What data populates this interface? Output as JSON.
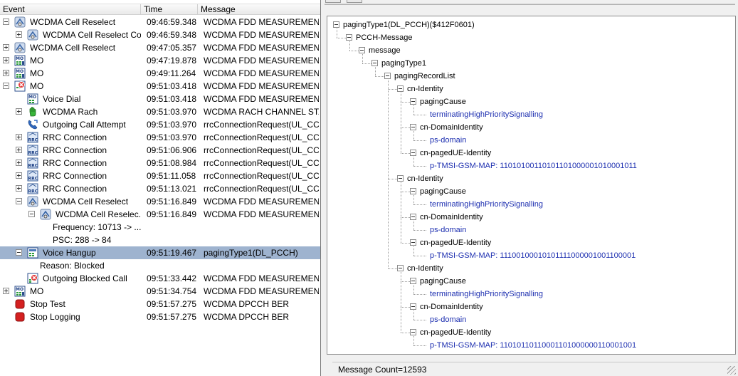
{
  "event_list": {
    "headers": {
      "event": "Event",
      "time": "Time",
      "message": "Message"
    },
    "rows": [
      {
        "indent": 0,
        "toggle": "minus",
        "icon": "cell-reselect",
        "event": "WCDMA Cell Reselect",
        "time": "09:46:59.348",
        "message": "WCDMA FDD MEASUREMENTS"
      },
      {
        "indent": 1,
        "toggle": "plus",
        "icon": "cell-reselect",
        "event": "WCDMA Cell Reselect Co...",
        "time": "09:46:59.348",
        "message": "WCDMA FDD MEASUREMENTS"
      },
      {
        "indent": 0,
        "toggle": "plus",
        "icon": "cell-reselect",
        "event": "WCDMA Cell Reselect",
        "time": "09:47:05.357",
        "message": "WCDMA FDD MEASUREMENTS"
      },
      {
        "indent": 0,
        "toggle": "plus",
        "icon": "mo",
        "event": "MO",
        "time": "09:47:19.878",
        "message": "WCDMA FDD MEASUREMENTS"
      },
      {
        "indent": 0,
        "toggle": "plus",
        "icon": "mo",
        "event": "MO",
        "time": "09:49:11.264",
        "message": "WCDMA FDD MEASUREMENTS"
      },
      {
        "indent": 0,
        "toggle": "minus",
        "icon": "mo-blocked",
        "event": "MO",
        "time": "09:51:03.418",
        "message": "WCDMA FDD MEASUREMENTS"
      },
      {
        "indent": 1,
        "toggle": "none",
        "icon": "voice-dial",
        "event": "Voice Dial",
        "time": "09:51:03.418",
        "message": "WCDMA FDD MEASUREMENTS"
      },
      {
        "indent": 1,
        "toggle": "plus",
        "icon": "rach-hand",
        "event": "WCDMA Rach",
        "time": "09:51:03.970",
        "message": "WCDMA RACH CHANNEL STATUS"
      },
      {
        "indent": 1,
        "toggle": "none",
        "icon": "call-attempt",
        "event": "Outgoing Call Attempt",
        "time": "09:51:03.970",
        "message": "rrcConnectionRequest(UL_CCCH)"
      },
      {
        "indent": 1,
        "toggle": "plus",
        "icon": "rrc",
        "event": "RRC Connection",
        "time": "09:51:03.970",
        "message": "rrcConnectionRequest(UL_CCCH)"
      },
      {
        "indent": 1,
        "toggle": "plus",
        "icon": "rrc",
        "event": "RRC Connection",
        "time": "09:51:06.906",
        "message": "rrcConnectionRequest(UL_CCCH)"
      },
      {
        "indent": 1,
        "toggle": "plus",
        "icon": "rrc",
        "event": "RRC Connection",
        "time": "09:51:08.984",
        "message": "rrcConnectionRequest(UL_CCCH)"
      },
      {
        "indent": 1,
        "toggle": "plus",
        "icon": "rrc",
        "event": "RRC Connection",
        "time": "09:51:11.058",
        "message": "rrcConnectionRequest(UL_CCCH)"
      },
      {
        "indent": 1,
        "toggle": "plus",
        "icon": "rrc",
        "event": "RRC Connection",
        "time": "09:51:13.021",
        "message": "rrcConnectionRequest(UL_CCCH)"
      },
      {
        "indent": 1,
        "toggle": "minus",
        "icon": "cell-reselect",
        "event": "WCDMA Cell Reselect",
        "time": "09:51:16.849",
        "message": "WCDMA FDD MEASUREMENTS"
      },
      {
        "indent": 2,
        "toggle": "minus",
        "icon": "cell-reselect",
        "event": "WCDMA Cell Reselec...",
        "time": "09:51:16.849",
        "message": "WCDMA FDD MEASUREMENTS"
      },
      {
        "indent": 3,
        "toggle": "none",
        "icon": "none",
        "event": "Frequency: 10713 -> ...",
        "time": "",
        "message": ""
      },
      {
        "indent": 3,
        "toggle": "none",
        "icon": "none",
        "event": "PSC: 288 -> 84",
        "time": "",
        "message": ""
      },
      {
        "indent": 1,
        "toggle": "minus",
        "icon": "voice-hangup",
        "event": "Voice Hangup",
        "time": "09:51:19.467",
        "message": "pagingType1(DL_PCCH)",
        "selected": true
      },
      {
        "indent": 2,
        "toggle": "none",
        "icon": "none",
        "event": "Reason: Blocked",
        "time": "",
        "message": ""
      },
      {
        "indent": 1,
        "toggle": "none",
        "icon": "blocked-call",
        "event": "Outgoing Blocked Call",
        "time": "09:51:33.442",
        "message": "WCDMA FDD MEASUREMENTS"
      },
      {
        "indent": 0,
        "toggle": "plus",
        "icon": "mo",
        "event": "MO",
        "time": "09:51:34.754",
        "message": "WCDMA FDD MEASUREMENTS"
      },
      {
        "indent": 0,
        "toggle": "none",
        "icon": "stop",
        "event": "Stop Test",
        "time": "09:51:57.275",
        "message": "WCDMA DPCCH BER"
      },
      {
        "indent": 0,
        "toggle": "none",
        "icon": "stop",
        "event": "Stop Logging",
        "time": "09:51:57.275",
        "message": "WCDMA DPCCH BER"
      }
    ]
  },
  "detail_tree": {
    "nodes": [
      {
        "depth": 0,
        "expander": true,
        "value": false,
        "text": "pagingType1(DL_PCCH)($412F0601)"
      },
      {
        "depth": 1,
        "expander": true,
        "value": false,
        "text": "PCCH-Message"
      },
      {
        "depth": 2,
        "expander": true,
        "value": false,
        "text": "message"
      },
      {
        "depth": 3,
        "expander": true,
        "value": false,
        "text": "pagingType1"
      },
      {
        "depth": 4,
        "expander": true,
        "value": false,
        "text": "pagingRecordList"
      },
      {
        "depth": 5,
        "expander": true,
        "value": false,
        "text": "cn-Identity"
      },
      {
        "depth": 6,
        "expander": true,
        "value": false,
        "text": "pagingCause"
      },
      {
        "depth": 7,
        "expander": false,
        "value": true,
        "text": "terminatingHighPrioritySignalling"
      },
      {
        "depth": 6,
        "expander": true,
        "value": false,
        "text": "cn-DomainIdentity"
      },
      {
        "depth": 7,
        "expander": false,
        "value": true,
        "text": "ps-domain"
      },
      {
        "depth": 6,
        "expander": true,
        "value": false,
        "text": "cn-pagedUE-Identity"
      },
      {
        "depth": 7,
        "expander": false,
        "value": true,
        "text": "p-TMSI-GSM-MAP: 11010100110101101000001010001011"
      },
      {
        "depth": 5,
        "expander": true,
        "value": false,
        "text": "cn-Identity"
      },
      {
        "depth": 6,
        "expander": true,
        "value": false,
        "text": "pagingCause"
      },
      {
        "depth": 7,
        "expander": false,
        "value": true,
        "text": "terminatingHighPrioritySignalling"
      },
      {
        "depth": 6,
        "expander": true,
        "value": false,
        "text": "cn-DomainIdentity"
      },
      {
        "depth": 7,
        "expander": false,
        "value": true,
        "text": "ps-domain"
      },
      {
        "depth": 6,
        "expander": true,
        "value": false,
        "text": "cn-pagedUE-Identity"
      },
      {
        "depth": 7,
        "expander": false,
        "value": true,
        "text": "p-TMSI-GSM-MAP: 11100100010101111000001001100001"
      },
      {
        "depth": 5,
        "expander": true,
        "value": false,
        "text": "cn-Identity"
      },
      {
        "depth": 6,
        "expander": true,
        "value": false,
        "text": "pagingCause"
      },
      {
        "depth": 7,
        "expander": false,
        "value": true,
        "text": "terminatingHighPrioritySignalling"
      },
      {
        "depth": 6,
        "expander": true,
        "value": false,
        "text": "cn-DomainIdentity"
      },
      {
        "depth": 7,
        "expander": false,
        "value": true,
        "text": "ps-domain"
      },
      {
        "depth": 6,
        "expander": true,
        "value": false,
        "text": "cn-pagedUE-Identity"
      },
      {
        "depth": 7,
        "expander": false,
        "value": true,
        "text": "p-TMSI-GSM-MAP: 11010110110001101000000110001001"
      }
    ]
  },
  "status": {
    "message_count": "Message Count=12593"
  },
  "colors": {
    "selection": "#9eb3cf",
    "tree_value": "#1d2fb0",
    "stop_red": "#d42020"
  }
}
